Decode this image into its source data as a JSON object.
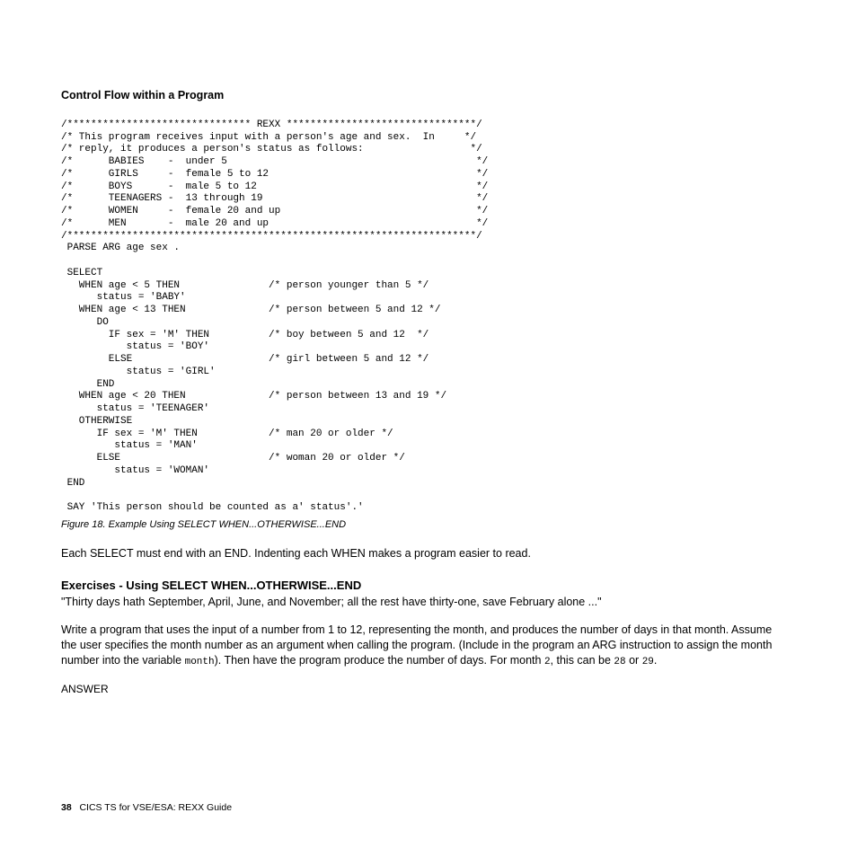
{
  "header": "Control Flow within a Program",
  "code_block": "/******************************* REXX ********************************/\n/* This program receives input with a person's age and sex.  In     */\n/* reply, it produces a person's status as follows:                  */\n/*      BABIES    -  under 5                                          */\n/*      GIRLS     -  female 5 to 12                                   */\n/*      BOYS      -  male 5 to 12                                     */\n/*      TEENAGERS -  13 through 19                                    */\n/*      WOMEN     -  female 20 and up                                 */\n/*      MEN       -  male 20 and up                                   */\n/*********************************************************************/\n PARSE ARG age sex .\n\n SELECT\n   WHEN age < 5 THEN               /* person younger than 5 */\n      status = 'BABY'\n   WHEN age < 13 THEN              /* person between 5 and 12 */\n      DO\n        IF sex = 'M' THEN          /* boy between 5 and 12  */\n           status = 'BOY'\n        ELSE                       /* girl between 5 and 12 */\n           status = 'GIRL'\n      END\n   WHEN age < 20 THEN              /* person between 13 and 19 */\n      status = 'TEENAGER'\n   OTHERWISE\n      IF sex = 'M' THEN            /* man 20 or older */\n         status = 'MAN'\n      ELSE                         /* woman 20 or older */\n         status = 'WOMAN'\n END\n\n SAY 'This person should be counted as a' status'.'",
  "figure_caption": "Figure 18. Example Using SELECT WHEN...OTHERWISE...END",
  "body1": "Each SELECT must end with an END. Indenting each WHEN makes a program easier to read.",
  "sub_heading": "Exercises - Using SELECT WHEN...OTHERWISE...END",
  "quote": "\"Thirty days hath September, April, June, and November; all the rest have thirty-one, save February alone ...\"",
  "body2_pre": "Write a program that uses the input of a number from 1 to 12, representing the month, and produces the number of days in that month. Assume the user specifies the month number as an argument when calling the program. (Include in the program an ARG instruction to assign the month number into the variable ",
  "body2_code1": "month",
  "body2_mid": "). Then have the program produce the number of days. For month ",
  "body2_code2": "2",
  "body2_mid2": ", this can be ",
  "body2_code3": "28",
  "body2_mid3": " or ",
  "body2_code4": "29",
  "body2_end": ".",
  "answer": "ANSWER",
  "footer_page": "38",
  "footer_text": "CICS TS for VSE/ESA: REXX Guide"
}
